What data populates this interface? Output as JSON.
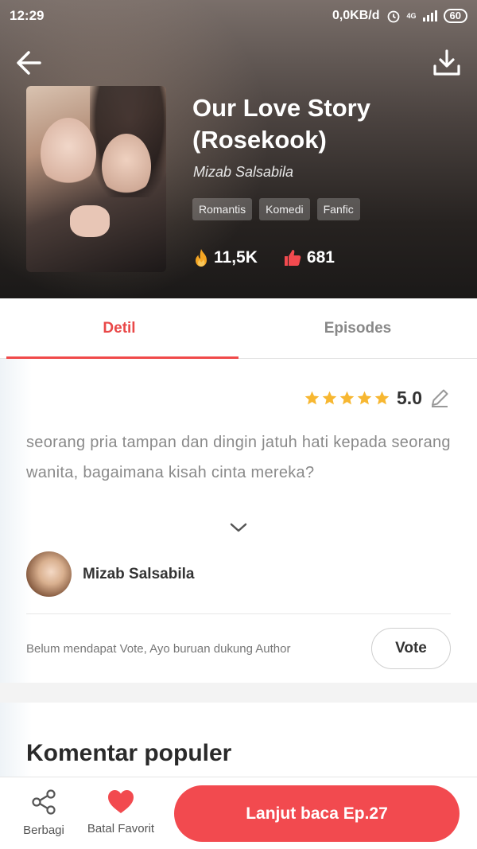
{
  "status_bar": {
    "time": "12:29",
    "network_speed": "0,0KB/d",
    "network_type": "4G",
    "battery": "60"
  },
  "header": {
    "back_icon": "arrow-left-icon",
    "download_icon": "download-icon"
  },
  "book": {
    "title": "Our Love Story (Rosekook)",
    "author": "Mizab Salsabila",
    "tags": [
      "Romantis",
      "Komedi",
      "Fanfic"
    ],
    "views": "11,5K",
    "likes": "681"
  },
  "tabs": [
    {
      "label": "Detil",
      "active": true
    },
    {
      "label": "Episodes",
      "active": false
    }
  ],
  "detail": {
    "rating_stars": 5,
    "rating_value": "5.0",
    "synopsis": "seorang pria tampan dan dingin jatuh hati kepada seorang wanita, bagaimana kisah cinta mereka?",
    "author_name": "Mizab Salsabila",
    "vote_prompt": "Belum mendapat Vote, Ayo buruan dukung Author",
    "vote_label": "Vote",
    "comments_title": "Komentar populer"
  },
  "bottom_bar": {
    "share_label": "Berbagi",
    "favorite_label": "Batal Favorit",
    "read_label": "Lanjut baca Ep.27"
  },
  "colors": {
    "accent": "#f24a4f",
    "tab_active": "#e94848",
    "star": "#f7b731"
  }
}
